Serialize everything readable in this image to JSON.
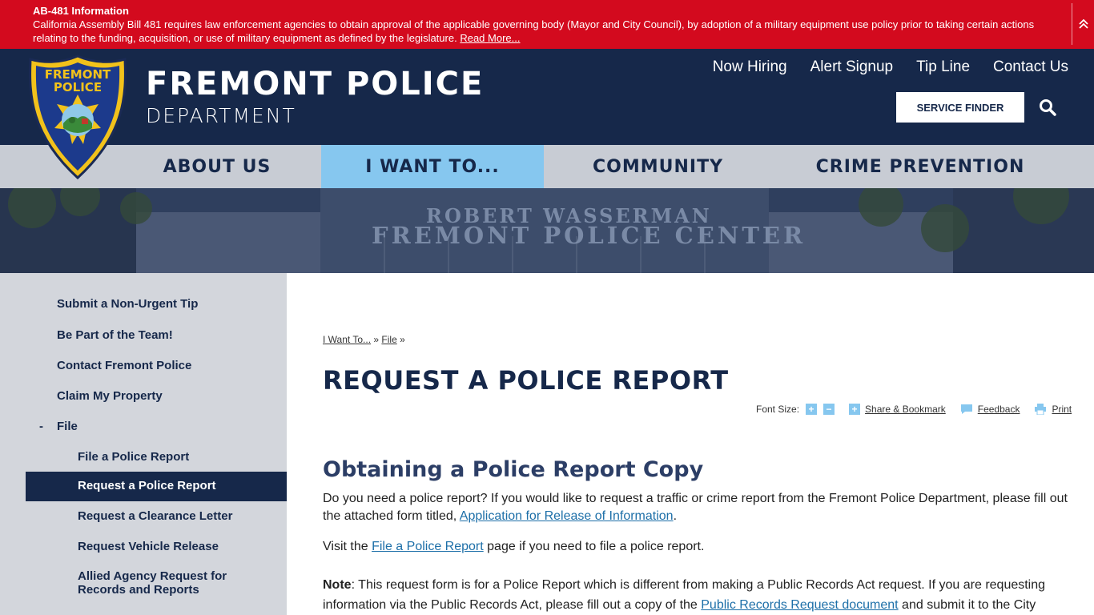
{
  "alert": {
    "title": "AB-481 Information",
    "text": "California Assembly Bill 481 requires law enforcement agencies to obtain approval of the applicable governing body (Mayor and City Council), by adoption of a military equipment use policy prior to taking certain actions relating to the funding, acquisition, or use of military equipment as defined by the legislature.",
    "link": "Read More..."
  },
  "header": {
    "brand_title": "FREMONT POLICE",
    "brand_sub": "DEPARTMENT",
    "badge_text": "FREMONT POLICE",
    "util_nav": [
      "Now Hiring",
      "Alert Signup",
      "Tip Line",
      "Contact Us"
    ],
    "service_finder": "SERVICE FINDER"
  },
  "main_nav": [
    "ABOUT US",
    "I WANT TO...",
    "COMMUNITY",
    "CRIME PREVENTION"
  ],
  "banner": {
    "line1": "ROBERT WASSERMAN",
    "line2": "FREMONT POLICE CENTER"
  },
  "sidebar": {
    "items": [
      "Submit a Non-Urgent Tip",
      "Be Part of the Team!",
      "Contact Fremont Police",
      "Claim My Property"
    ],
    "file_toggle": "-",
    "file_label": "File",
    "sub_items": [
      "File a Police Report",
      "Request a Police Report",
      "Request a Clearance Letter",
      "Request Vehicle Release",
      "Allied Agency Request for Records and Reports"
    ]
  },
  "breadcrumb": {
    "link1": "I Want To...",
    "sep": "»",
    "link2": "File"
  },
  "page_title": "REQUEST A POLICE REPORT",
  "tools": {
    "font_size": "Font Size:",
    "plus": "+",
    "minus": "−",
    "share": "Share & Bookmark",
    "feedback": "Feedback",
    "print": "Print"
  },
  "content": {
    "section_title": "Obtaining a Police Report Copy",
    "p1_text": "Do you need a police report? If you would like to request a traffic or crime report from the Fremont Police Department, please fill out the attached form titled, ",
    "p1_link": "Application for Release of Information",
    "p2_pre": "Visit the ",
    "p2_link": "File a Police Report",
    "p2_post": " page if you need to file a police report.",
    "p3_bold": "Note",
    "p3_text": ": This request form is for a Police Report which is different from making a Public Records Act request. If you are requesting information via the Public Records Act, please fill out a copy of the ",
    "p3_link": "Public Records Request document",
    "p3_post": " and submit it to the City"
  },
  "colors": {
    "alert": "#d30a1e",
    "navy": "#16284a",
    "active_nav": "#86c7ef",
    "sidebar": "#d3d6dc",
    "link": "#1d6fa8"
  }
}
